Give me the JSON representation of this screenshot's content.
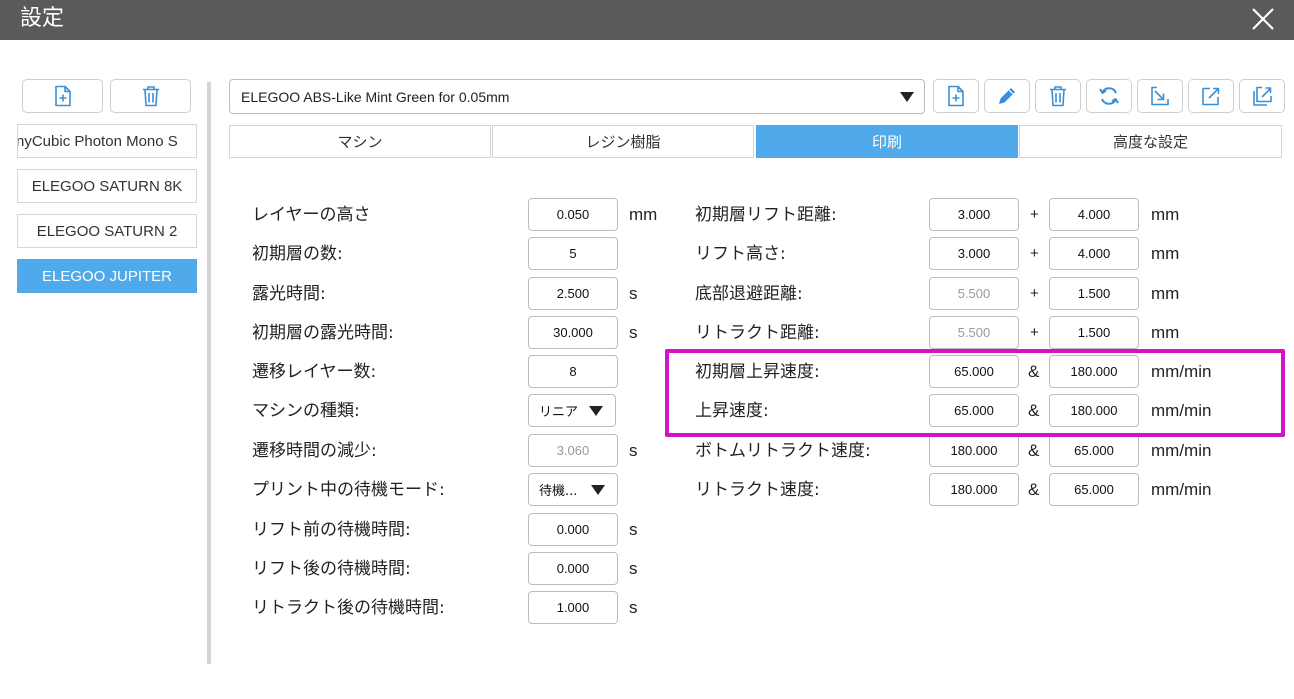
{
  "window": {
    "title": "設定"
  },
  "machines": [
    {
      "label": "AnyCubic Photon Mono S",
      "selected": false
    },
    {
      "label": "ELEGOO SATURN 8K",
      "selected": false
    },
    {
      "label": "ELEGOO SATURN 2",
      "selected": false
    },
    {
      "label": "ELEGOO JUPITER",
      "selected": true
    }
  ],
  "preset": {
    "value": "ELEGOO ABS-Like Mint Green for 0.05mm"
  },
  "tabs": [
    {
      "label": "マシン",
      "active": false
    },
    {
      "label": "レジン樹脂",
      "active": false
    },
    {
      "label": "印刷",
      "active": true
    },
    {
      "label": "高度な設定",
      "active": false
    }
  ],
  "left_params": [
    {
      "label": "レイヤーの高さ",
      "value": "0.050",
      "unit": "mm"
    },
    {
      "label": "初期層の数:",
      "value": "5",
      "unit": ""
    },
    {
      "label": "露光時間:",
      "value": "2.500",
      "unit": "s"
    },
    {
      "label": "初期層の露光時間:",
      "value": "30.000",
      "unit": "s"
    },
    {
      "label": "遷移レイヤー数:",
      "value": "8",
      "unit": ""
    },
    {
      "label": "マシンの種類:",
      "value": "リニア",
      "unit": ""
    },
    {
      "label": "遷移時間の減少:",
      "value": "3.060",
      "unit": "s"
    },
    {
      "label": "プリント中の待機モード:",
      "value": "待機...",
      "unit": ""
    },
    {
      "label": "リフト前の待機時間:",
      "value": "0.000",
      "unit": "s"
    },
    {
      "label": "リフト後の待機時間:",
      "value": "0.000",
      "unit": "s"
    },
    {
      "label": "リトラクト後の待機時間:",
      "value": "1.000",
      "unit": "s"
    }
  ],
  "right_params": [
    {
      "label": "初期層リフト距離:",
      "value1": "3.000",
      "op": "+",
      "value2": "4.000",
      "unit": "mm"
    },
    {
      "label": "リフト高さ:",
      "value1": "3.000",
      "op": "+",
      "value2": "4.000",
      "unit": "mm"
    },
    {
      "label": "底部退避距離:",
      "value1": "5.500",
      "op": "+",
      "value2": "1.500",
      "unit": "mm"
    },
    {
      "label": "リトラクト距離:",
      "value1": "5.500",
      "op": "+",
      "value2": "1.500",
      "unit": "mm"
    },
    {
      "label": "初期層上昇速度:",
      "value1": "65.000",
      "op": "&",
      "value2": "180.000",
      "unit": "mm/min"
    },
    {
      "label": "上昇速度:",
      "value1": "65.000",
      "op": "&",
      "value2": "180.000",
      "unit": "mm/min"
    },
    {
      "label": "ボトムリトラクト速度:",
      "value1": "180.000",
      "op": "&",
      "value2": "65.000",
      "unit": "mm/min"
    },
    {
      "label": "リトラクト速度:",
      "value1": "180.000",
      "op": "&",
      "value2": "65.000",
      "unit": "mm/min"
    }
  ],
  "icons": {
    "close": "close-icon",
    "machine_add": "add-file-icon",
    "machine_delete": "trash-icon",
    "preset_actions": [
      "add-file-icon",
      "pencil-icon",
      "trash-icon",
      "refresh-icon",
      "import-icon",
      "export-icon",
      "export-copy-icon"
    ]
  },
  "colors": {
    "accent": "#4fa9ea",
    "highlight": "#d313c5",
    "titlebar": "#5a5a5a",
    "icon": "#3a8fd6"
  }
}
